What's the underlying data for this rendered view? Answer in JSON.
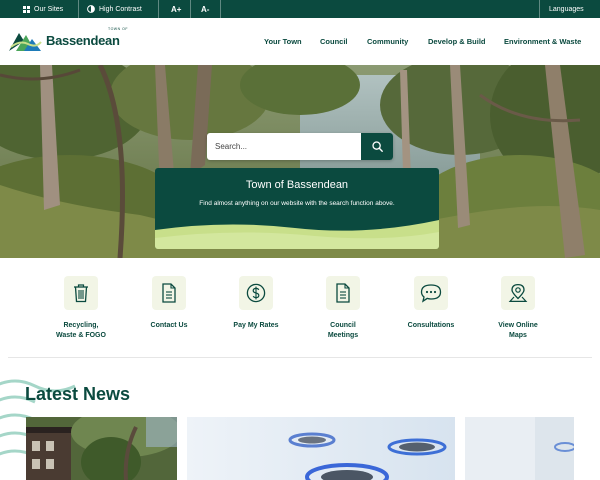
{
  "utility": {
    "our_sites": "Our Sites",
    "high_contrast": "High Contrast",
    "font_increase": "A+",
    "font_decrease": "A-",
    "languages": "Languages"
  },
  "logo": {
    "small_text": "TOWN OF",
    "name": "Bassendean"
  },
  "nav": {
    "items": [
      "Your Town",
      "Council",
      "Community",
      "Develop & Build",
      "Environment & Waste"
    ]
  },
  "hero": {
    "search_placeholder": "Search...",
    "card_title": "Town of Bassendean",
    "card_subtitle": "Find almost anything on our website with the search function above."
  },
  "quicklinks": [
    {
      "label": "Recycling,\nWaste & FOGO",
      "icon": "trash-icon"
    },
    {
      "label": "Contact Us",
      "icon": "document-icon"
    },
    {
      "label": "Pay My Rates",
      "icon": "dollar-icon"
    },
    {
      "label": "Council\nMeetings",
      "icon": "document-icon"
    },
    {
      "label": "Consultations",
      "icon": "chat-bubble-icon"
    },
    {
      "label": "View Online\nMaps",
      "icon": "map-pin-icon"
    }
  ],
  "news": {
    "heading": "Latest News"
  },
  "colors": {
    "primary": "#0b4a3f",
    "accent_lime": "#c8df8a",
    "tile_bg": "#f2f5e6"
  }
}
